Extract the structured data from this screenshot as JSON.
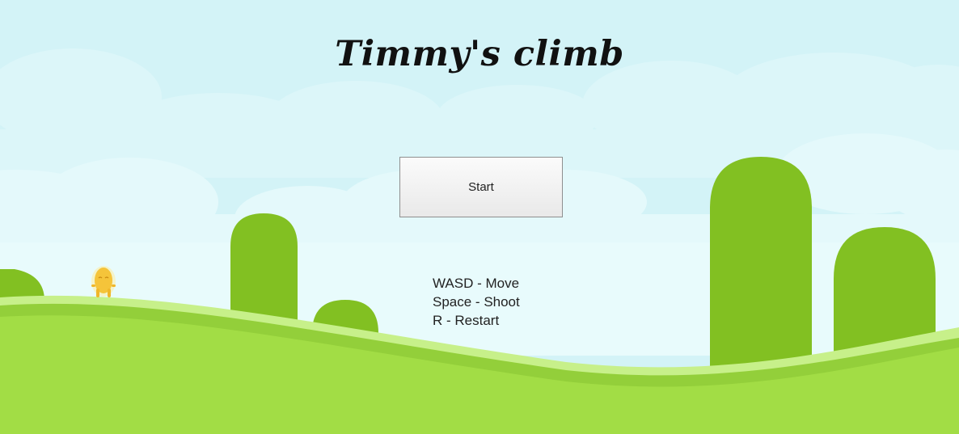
{
  "title": "Timmy's climb",
  "start_label": "Start",
  "controls": [
    {
      "key": "WASD",
      "sep": " - ",
      "action": "Move"
    },
    {
      "key": "Space",
      "sep": " - ",
      "action": "Shoot"
    },
    {
      "key": "R",
      "sep": " - ",
      "action": "Restart"
    }
  ],
  "colors": {
    "sky": "#d3f3f7",
    "cloud_light": "#e3f8fa",
    "cloud_pale": "#ebfbfc",
    "hill_green": "#82c022",
    "ground_green": "#a2dd45",
    "ground_edge": "#c7f08a",
    "ground_shadow": "#93cf3a",
    "character_yellow": "#f5c43a"
  },
  "icons": {
    "character": "player-character-icon"
  }
}
